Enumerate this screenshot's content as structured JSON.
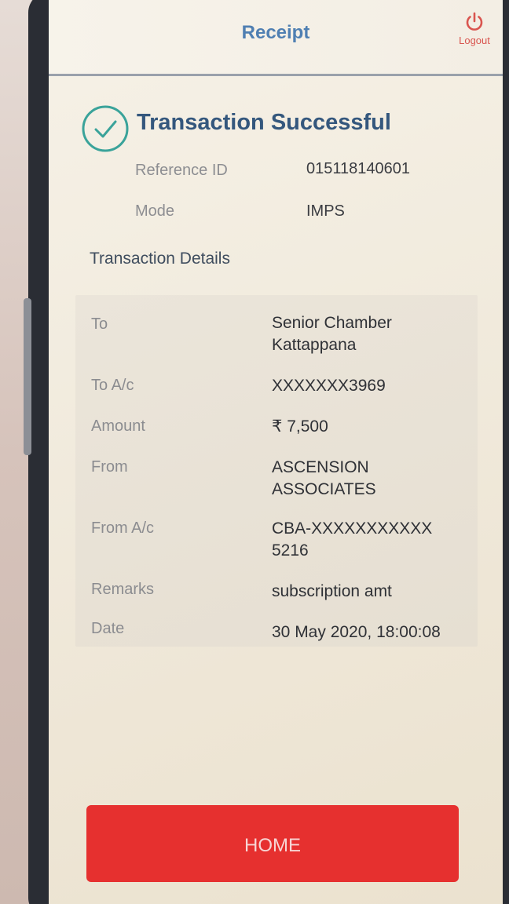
{
  "header": {
    "title": "Receipt",
    "logout_label": "Logout",
    "logout_icon": "power-icon"
  },
  "status": {
    "title": "Transaction Successful",
    "icon": "check-circle-icon",
    "accent_color": "#3aa39a"
  },
  "summary": {
    "reference_label": "Reference ID",
    "reference_value": "015118140601",
    "mode_label": "Mode",
    "mode_value": "IMPS"
  },
  "details": {
    "section_title": "Transaction Details",
    "rows": [
      {
        "label": "To",
        "value": "Senior Chamber Kattappana"
      },
      {
        "label": "To A/c",
        "value": "XXXXXXX3969"
      },
      {
        "label": "Amount",
        "value": "₹ 7,500"
      },
      {
        "label": "From",
        "value": "ASCENSION ASSOCIATES"
      },
      {
        "label": "From A/c",
        "value": "CBA-XXXXXXXXXXX5216"
      },
      {
        "label": "Remarks",
        "value": "subscription amt"
      },
      {
        "label": "Date",
        "value": "30 May 2020, 18:00:08"
      }
    ]
  },
  "home_button": {
    "label": "HOME",
    "color": "#e6302f"
  }
}
